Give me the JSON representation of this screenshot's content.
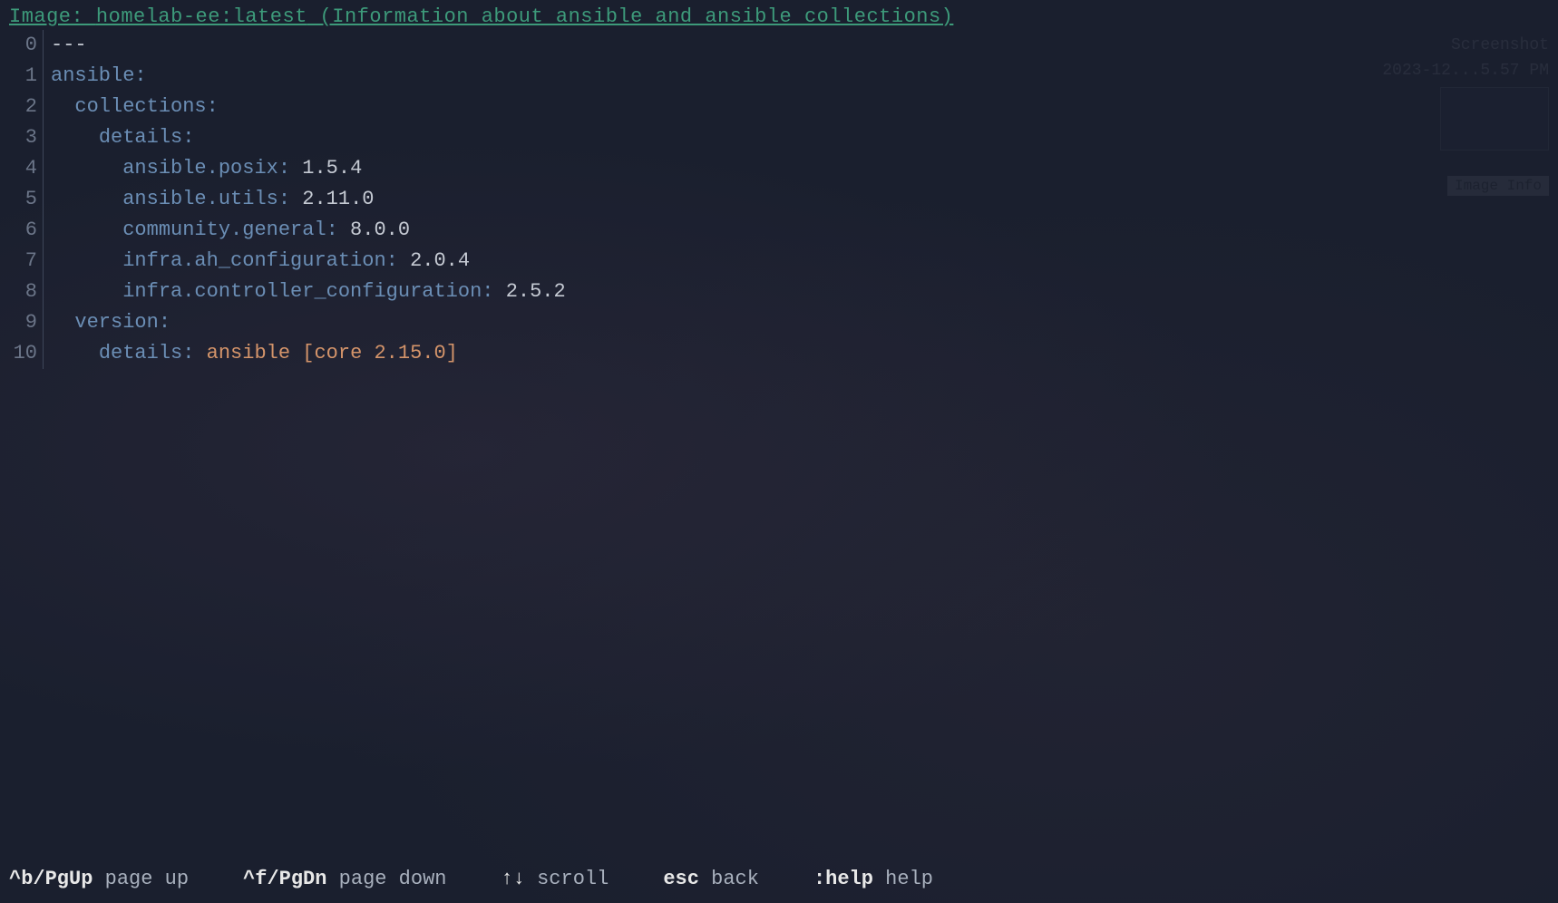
{
  "header": {
    "prefix": "Image: ",
    "image_name": "homelab-ee:latest",
    "description": " (Information about ansible and ansible collections)"
  },
  "lines": [
    {
      "num": "0",
      "indent": "",
      "key": "",
      "value": "---",
      "value_class": "dash"
    },
    {
      "num": "1",
      "indent": "",
      "key": "ansible",
      "value": "",
      "value_class": ""
    },
    {
      "num": "2",
      "indent": "  ",
      "key": "collections",
      "value": "",
      "value_class": ""
    },
    {
      "num": "3",
      "indent": "    ",
      "key": "details",
      "value": "",
      "value_class": ""
    },
    {
      "num": "4",
      "indent": "      ",
      "key": "ansible.posix",
      "value": " 1.5.4",
      "value_class": "value-num"
    },
    {
      "num": "5",
      "indent": "      ",
      "key": "ansible.utils",
      "value": " 2.11.0",
      "value_class": "value-num"
    },
    {
      "num": "6",
      "indent": "      ",
      "key": "community.general",
      "value": " 8.0.0",
      "value_class": "value-num"
    },
    {
      "num": "7",
      "indent": "      ",
      "key": "infra.ah_configuration",
      "value": " 2.0.4",
      "value_class": "value-num"
    },
    {
      "num": "8",
      "indent": "      ",
      "key": "infra.controller_configuration",
      "value": " 2.5.2",
      "value_class": "value-num"
    },
    {
      "num": "9",
      "indent": "  ",
      "key": "version",
      "value": "",
      "value_class": ""
    },
    {
      "num": "10",
      "indent": "    ",
      "key": "details",
      "value": " ansible [core 2.15.0]",
      "value_class": "value-str"
    }
  ],
  "footer": [
    {
      "key": "^b/PgUp",
      "label": " page up"
    },
    {
      "key": "^f/PgDn",
      "label": " page down"
    },
    {
      "key": "↑↓",
      "label": " scroll"
    },
    {
      "key": "esc",
      "label": " back"
    },
    {
      "key": ":help",
      "label": " help"
    }
  ],
  "background": {
    "timestamp": "2023-12...5.57 PM",
    "screenshot_label": "Screenshot",
    "button": "Image Info"
  }
}
